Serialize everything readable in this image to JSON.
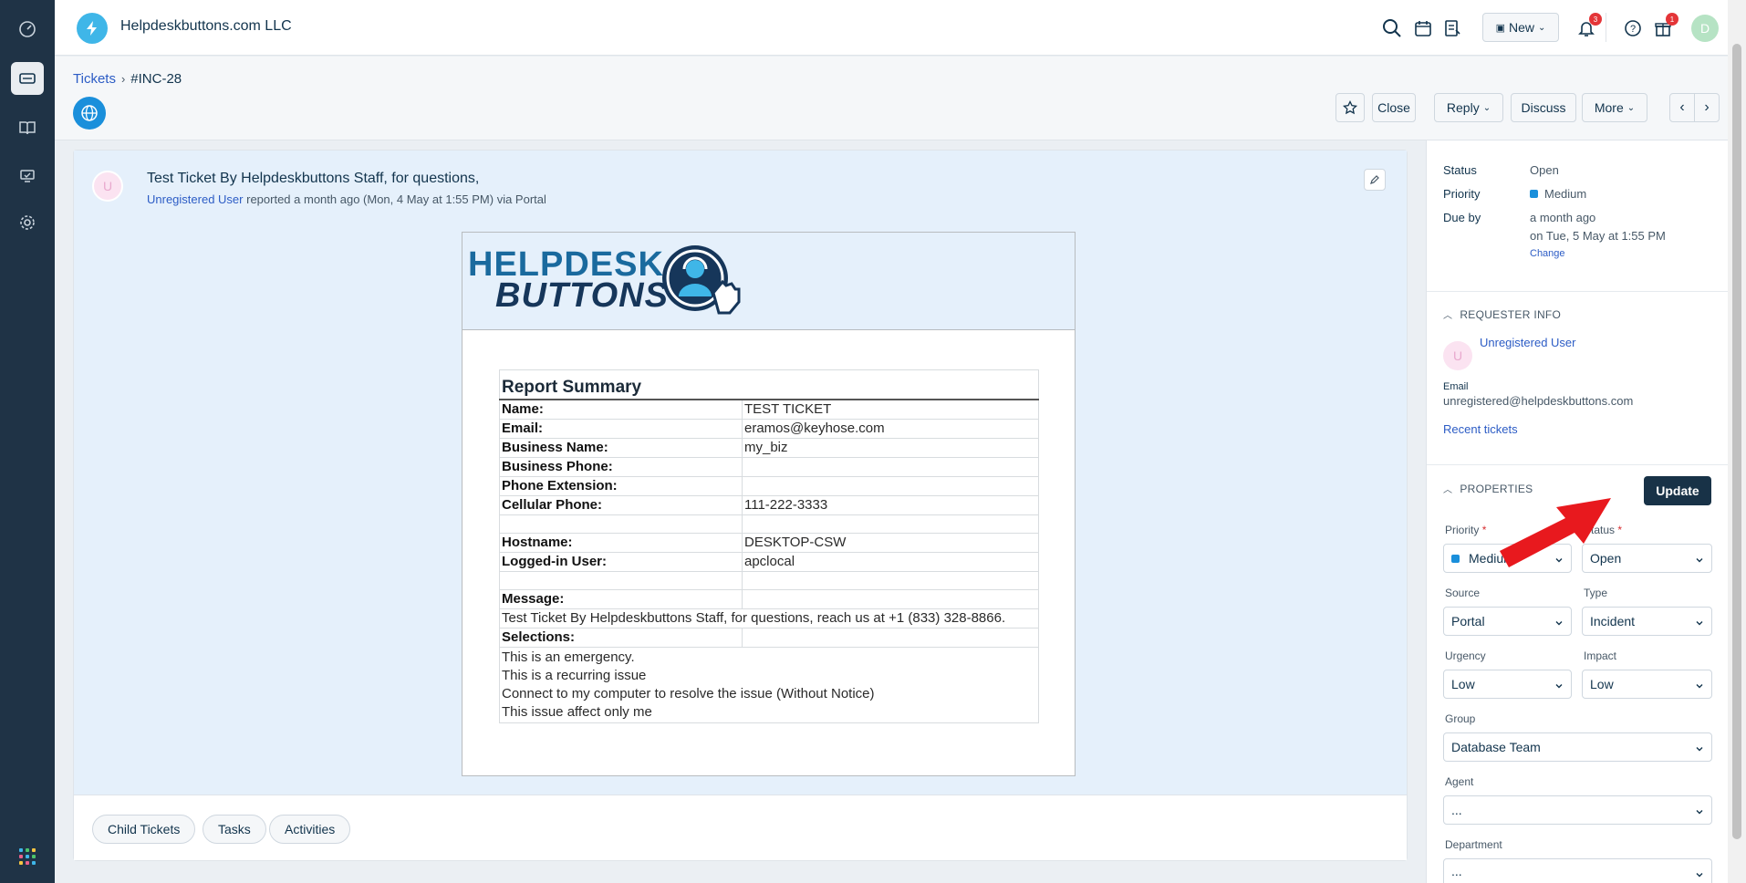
{
  "brand": {
    "name": "Helpdeskbuttons.com LLC",
    "logo_icon": "lightning-icon"
  },
  "leftnav": {
    "items": [
      "dashboard-icon",
      "tickets-icon",
      "solutions-icon",
      "assets-icon",
      "settings-icon"
    ],
    "apps_icon": "apps-grid-icon"
  },
  "topbar": {
    "new_label": "New",
    "notifications_count": "3",
    "gifts_count": "1",
    "avatar_letter": "D"
  },
  "breadcrumb": {
    "root": "Tickets",
    "current": "#INC-28"
  },
  "actions": {
    "close": "Close",
    "reply": "Reply",
    "discuss": "Discuss",
    "more": "More"
  },
  "ticket": {
    "avatar_letter": "U",
    "title": "Test Ticket By Helpdeskbuttons Staff, for questions,",
    "requester": "Unregistered User",
    "meta": " reported a month ago (Mon, 4 May at 1:55 PM) via Portal"
  },
  "email": {
    "logo_line1": "HELPDESK",
    "logo_line2": "BUTTONS",
    "report_title": "Report Summary",
    "rows": [
      {
        "label": "Name:",
        "value": "TEST TICKET"
      },
      {
        "label": "Email:",
        "value": "eramos@keyhose.com"
      },
      {
        "label": "Business Name:",
        "value": "my_biz"
      },
      {
        "label": "Business Phone:",
        "value": ""
      },
      {
        "label": "Phone Extension:",
        "value": ""
      },
      {
        "label": "Cellular Phone:",
        "value": "111-222-3333"
      },
      {
        "label": "Hostname:",
        "value": "DESKTOP-CSW"
      },
      {
        "label": "Logged-in User:",
        "value": "apclocal"
      }
    ],
    "message_label": "Message:",
    "message": "Test Ticket By Helpdeskbuttons Staff, for questions, reach us at +1 (833) 328-8866.",
    "selections_label": "Selections:",
    "selections": "This is an emergency.\nThis is a recurring issue\nConnect to my computer to resolve the issue (Without Notice)\nThis issue affect only me"
  },
  "footer_tabs": [
    "Child Tickets",
    "Tasks",
    "Activities"
  ],
  "summary": {
    "status_label": "Status",
    "status_value": "Open",
    "priority_label": "Priority",
    "priority_value": "Medium",
    "due_label": "Due by",
    "due_value": "a month ago",
    "due_date": "on Tue, 5 May at 1:55 PM",
    "change_link": "Change"
  },
  "requester_info": {
    "title": "REQUESTER INFO",
    "avatar_letter": "U",
    "name": "Unregistered User",
    "email_label": "Email",
    "email": "unregistered@helpdeskbuttons.com",
    "recent_link": "Recent tickets"
  },
  "properties": {
    "title": "PROPERTIES",
    "update_label": "Update",
    "priority_label": "Priority",
    "priority_value": "Medium",
    "status_label": "Status",
    "status_value": "Open",
    "source_label": "Source",
    "source_value": "Portal",
    "type_label": "Type",
    "type_value": "Incident",
    "urgency_label": "Urgency",
    "urgency_value": "Low",
    "impact_label": "Impact",
    "impact_value": "Low",
    "group_label": "Group",
    "group_value": "Database Team",
    "agent_label": "Agent",
    "agent_value": "...",
    "department_label": "Department",
    "department_value": "..."
  },
  "colors": {
    "accent": "#2c5cc5",
    "nav": "#1f3346",
    "annotation_arrow": "#e8191e",
    "priority_medium": "#1a8fdb"
  }
}
